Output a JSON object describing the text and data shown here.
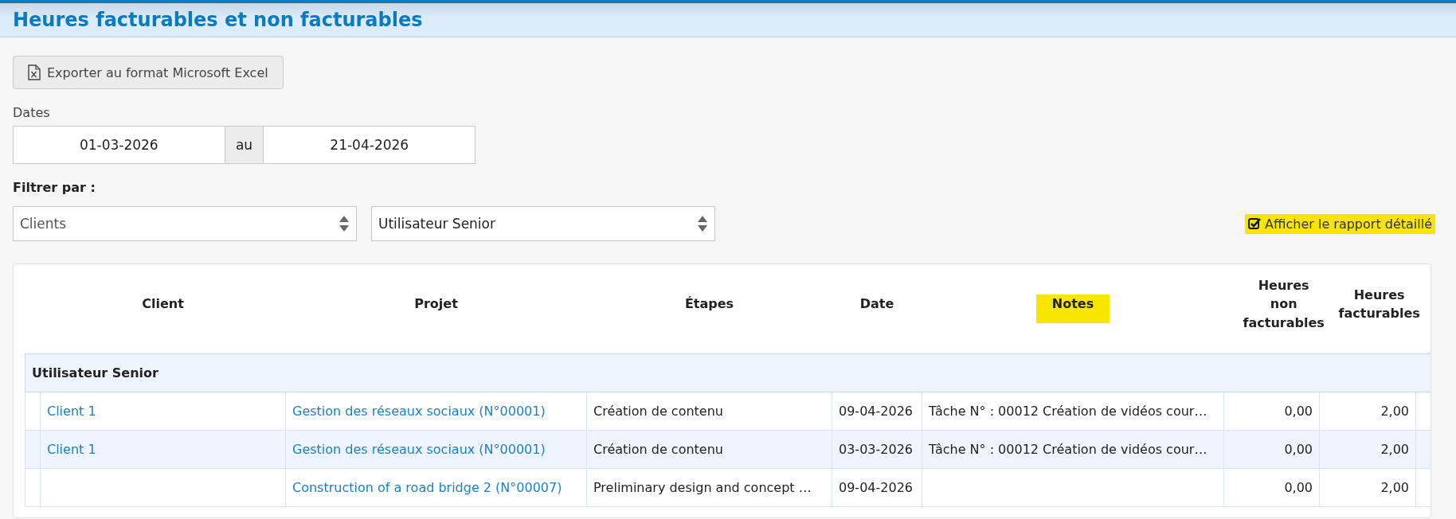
{
  "title": "Heures facturables et non facturables",
  "export_button": {
    "label": "Exporter au format Microsoft Excel"
  },
  "dates": {
    "label": "Dates",
    "from": "01-03-2026",
    "separator": "au",
    "to": "21-04-2026"
  },
  "filter": {
    "label": "Filtrer par :",
    "selects": [
      {
        "placeholder": "Clients"
      },
      {
        "value": "Utilisateur Senior"
      }
    ]
  },
  "detailed_report": {
    "label": "Afficher le rapport détaillé",
    "checked": true,
    "highlighted": true
  },
  "table": {
    "columns": [
      {
        "label": "Client",
        "highlighted": false
      },
      {
        "label": "Projet",
        "highlighted": false
      },
      {
        "label": "Étapes",
        "highlighted": false
      },
      {
        "label": "Date",
        "highlighted": false
      },
      {
        "label": "Notes",
        "highlighted": true
      },
      {
        "label": "Heures non facturables",
        "highlighted": false
      },
      {
        "label": "Heures facturables",
        "highlighted": false
      }
    ],
    "group": "Utilisateur Senior",
    "rows": [
      {
        "client": "Client 1",
        "project": "Gestion des réseaux sociaux (N°00001)",
        "step": "Création de contenu",
        "date": "09-04-2026",
        "notes": "Tâche N° : 00012 Création de vidéos cour…",
        "non_billable": "0,00",
        "billable": "2,00"
      },
      {
        "client": "Client 1",
        "project": "Gestion des réseaux sociaux (N°00001)",
        "step": "Création de contenu",
        "date": "03-03-2026",
        "notes": "Tâche N° : 00012 Création de vidéos cour…",
        "non_billable": "0,00",
        "billable": "2,00"
      },
      {
        "project": "Construction of a road bridge 2 (N°00007)",
        "step": "Preliminary design and concept …",
        "date": "09-04-2026",
        "non_billable": "0,00",
        "billable": "2,00"
      }
    ]
  }
}
